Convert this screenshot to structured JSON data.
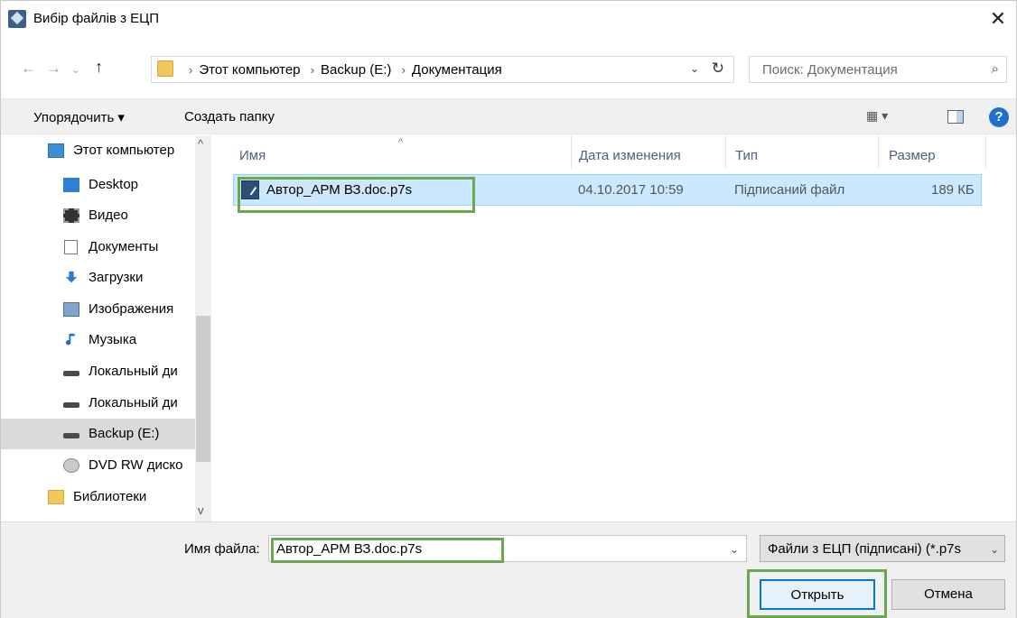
{
  "window": {
    "title": "Вибір файлів з ЕЦП",
    "close": "✕"
  },
  "nav": {
    "back": "←",
    "forward": "→",
    "recent": "⌄",
    "up": "↑",
    "breadcrumb": [
      "Этот компьютер",
      "Backup (E:)",
      "Документация"
    ],
    "separator": "›",
    "dropdown": "⌄",
    "refresh": "↻",
    "search_placeholder": "Поиск: Документация",
    "search_icon": "⌕"
  },
  "toolbar": {
    "arrange_label": "Упорядочить ▾",
    "new_folder_label": "Создать папку",
    "view_icon": "▦ ▾",
    "help": "?"
  },
  "sidebar": {
    "items": [
      {
        "label": "Этот компьютер",
        "icon": "pc-icon"
      },
      {
        "label": "Desktop",
        "icon": "desktop-icon"
      },
      {
        "label": "Видео",
        "icon": "video-icon"
      },
      {
        "label": "Документы",
        "icon": "documents-icon"
      },
      {
        "label": "Загрузки",
        "icon": "downloads-icon"
      },
      {
        "label": "Изображения",
        "icon": "images-icon"
      },
      {
        "label": "Музыка",
        "icon": "music-icon"
      },
      {
        "label": "Локальный ди",
        "icon": "drive-icon"
      },
      {
        "label": "Локальный ди",
        "icon": "drive-icon"
      },
      {
        "label": "Backup (E:)",
        "icon": "drive-icon"
      },
      {
        "label": "DVD RW диско",
        "icon": "dvd-icon"
      },
      {
        "label": "Библиотеки",
        "icon": "library-icon"
      }
    ],
    "scroll_up": "^",
    "scroll_down": "v"
  },
  "list": {
    "columns": [
      "Имя",
      "Дата изменения",
      "Тип",
      "Размер"
    ],
    "sort_indicator": "^",
    "rows": [
      {
        "name": "Автор_АРМ ВЗ.doc.p7s",
        "date": "04.10.2017 10:59",
        "type": "Підписаний файл",
        "size": "189 КБ"
      }
    ]
  },
  "bottom": {
    "filename_label": "Имя файла:",
    "filename_value": "Автор_АРМ ВЗ.doc.p7s",
    "filename_dropdown": "⌄",
    "filter_value": "Файли з ЕЦП (підписані) (*.p7s",
    "filter_dropdown": "⌄",
    "open_label": "Открыть",
    "cancel_label": "Отмена"
  },
  "colors": {
    "highlight": "#6aa84f",
    "selection": "#cce8ff",
    "accent": "#0078d7"
  }
}
